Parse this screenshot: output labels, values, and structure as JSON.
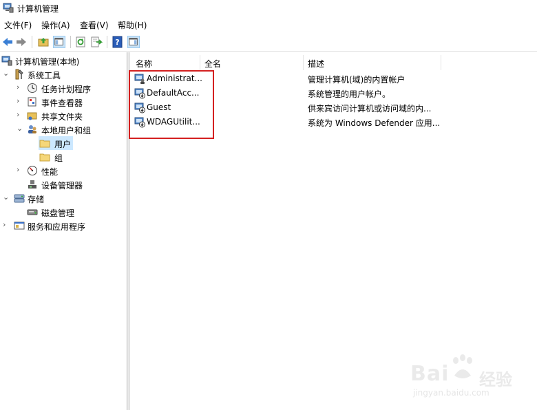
{
  "window": {
    "title": "计算机管理",
    "app_icon": "computer-management-icon"
  },
  "menu": [
    "文件(F)",
    "操作(A)",
    "查看(V)",
    "帮助(H)"
  ],
  "toolbar": {
    "buttons": [
      "back-arrow-icon",
      "forward-arrow-icon",
      "up-folder-icon",
      "show-hide-console-tree-icon",
      "refresh-icon",
      "export-list-icon",
      "help-icon",
      "action-pane-icon"
    ]
  },
  "tree": {
    "root": "计算机管理(本地)",
    "system_tools": "系统工具",
    "task_scheduler": "任务计划程序",
    "event_viewer": "事件查看器",
    "shared_folders": "共享文件夹",
    "local_users_groups": "本地用户和组",
    "users": "用户",
    "groups": "组",
    "performance": "性能",
    "device_manager": "设备管理器",
    "storage": "存储",
    "disk_management": "磁盘管理",
    "services_apps": "服务和应用程序"
  },
  "list": {
    "columns": [
      "名称",
      "全名",
      "描述"
    ],
    "rows": [
      {
        "name": "Administrat...",
        "fullname": "",
        "desc": "管理计算机(域)的内置帐户"
      },
      {
        "name": "DefaultAcc...",
        "fullname": "",
        "desc": "系统管理的用户帐户。"
      },
      {
        "name": "Guest",
        "fullname": "",
        "desc": "供来宾访问计算机或访问域的内..."
      },
      {
        "name": "WDAGUtilit...",
        "fullname": "",
        "desc": "系统为 Windows Defender 应用..."
      }
    ]
  },
  "watermark": {
    "brand": "Bai",
    "brand2": "经验",
    "url": "jingyan.baidu.com"
  },
  "colors": {
    "highlight_box": "#d42020",
    "selection": "#cce8ff"
  }
}
